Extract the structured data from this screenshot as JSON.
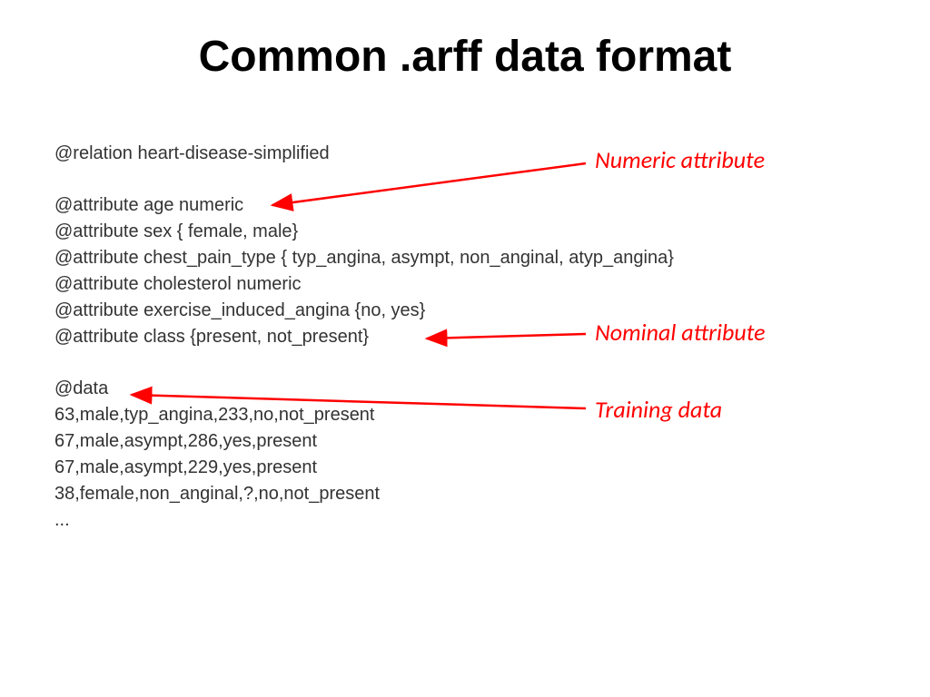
{
  "title": "Common .arff data format",
  "code": {
    "relation": "@relation heart-disease-simplified",
    "attr1": "@attribute age numeric",
    "attr2": "@attribute sex { female, male}",
    "attr3": "@attribute chest_pain_type { typ_angina, asympt, non_anginal, atyp_angina}",
    "attr4": "@attribute cholesterol numeric",
    "attr5": "@attribute exercise_induced_angina {no, yes}",
    "attr6": "@attribute class {present, not_present}",
    "data_header": "@data",
    "row1": "63,male,typ_angina,233,no,not_present",
    "row2": "67,male,asympt,286,yes,present",
    "row3": "67,male,asympt,229,yes,present",
    "row4": "38,female,non_anginal,?,no,not_present",
    "ellipsis": "..."
  },
  "annotations": {
    "numeric": "Numeric attribute",
    "nominal": "Nominal attribute",
    "training": "Training data"
  }
}
